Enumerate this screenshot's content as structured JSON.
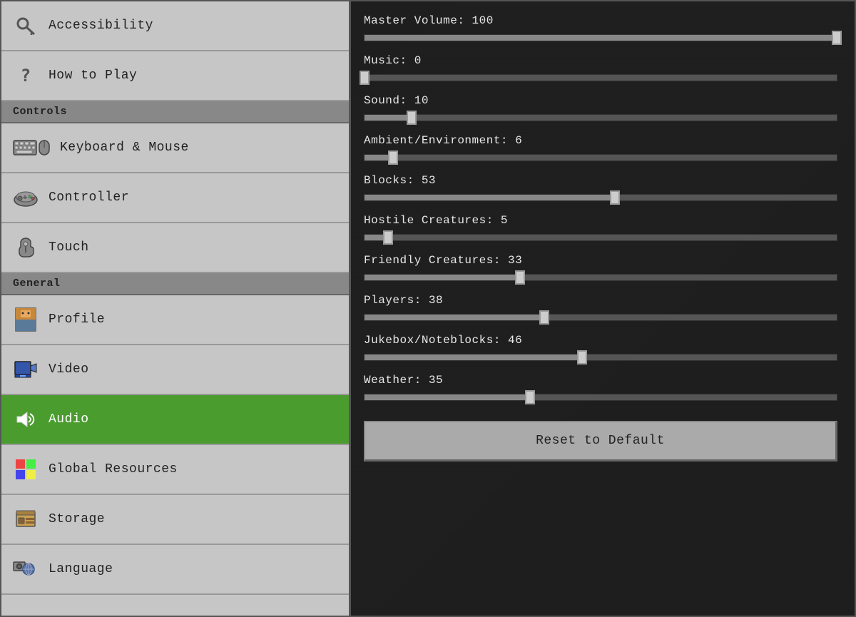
{
  "sidebar": {
    "sections": [
      {
        "items": [
          {
            "id": "accessibility",
            "label": "Accessibility",
            "icon": "key"
          },
          {
            "id": "how-to-play",
            "label": "How to Play",
            "icon": "question"
          }
        ]
      },
      {
        "header": "Controls",
        "items": [
          {
            "id": "keyboard-mouse",
            "label": "Keyboard & Mouse",
            "icon": "keyboard"
          },
          {
            "id": "controller",
            "label": "Controller",
            "icon": "controller"
          },
          {
            "id": "touch",
            "label": "Touch",
            "icon": "touch"
          }
        ]
      },
      {
        "header": "General",
        "items": [
          {
            "id": "profile",
            "label": "Profile",
            "icon": "profile"
          },
          {
            "id": "video",
            "label": "Video",
            "icon": "video"
          },
          {
            "id": "audio",
            "label": "Audio",
            "icon": "audio",
            "active": true
          },
          {
            "id": "global-resources",
            "label": "Global Resources",
            "icon": "global"
          },
          {
            "id": "storage",
            "label": "Storage",
            "icon": "storage"
          },
          {
            "id": "language",
            "label": "Language",
            "icon": "language"
          }
        ]
      }
    ]
  },
  "main": {
    "sliders": [
      {
        "id": "master-volume",
        "label": "Master Volume",
        "value": 100,
        "percent": 100
      },
      {
        "id": "music",
        "label": "Music",
        "value": 0,
        "percent": 0
      },
      {
        "id": "sound",
        "label": "Sound",
        "value": 10,
        "percent": 10
      },
      {
        "id": "ambient",
        "label": "Ambient/Environment",
        "value": 6,
        "percent": 6
      },
      {
        "id": "blocks",
        "label": "Blocks",
        "value": 53,
        "percent": 53
      },
      {
        "id": "hostile-creatures",
        "label": "Hostile Creatures",
        "value": 5,
        "percent": 5
      },
      {
        "id": "friendly-creatures",
        "label": "Friendly Creatures",
        "value": 33,
        "percent": 33
      },
      {
        "id": "players",
        "label": "Players",
        "value": 38,
        "percent": 38
      },
      {
        "id": "jukebox",
        "label": "Jukebox/Noteblocks",
        "value": 46,
        "percent": 46
      },
      {
        "id": "weather",
        "label": "Weather",
        "value": 35,
        "percent": 35
      }
    ],
    "reset_button_label": "Reset to Default"
  }
}
